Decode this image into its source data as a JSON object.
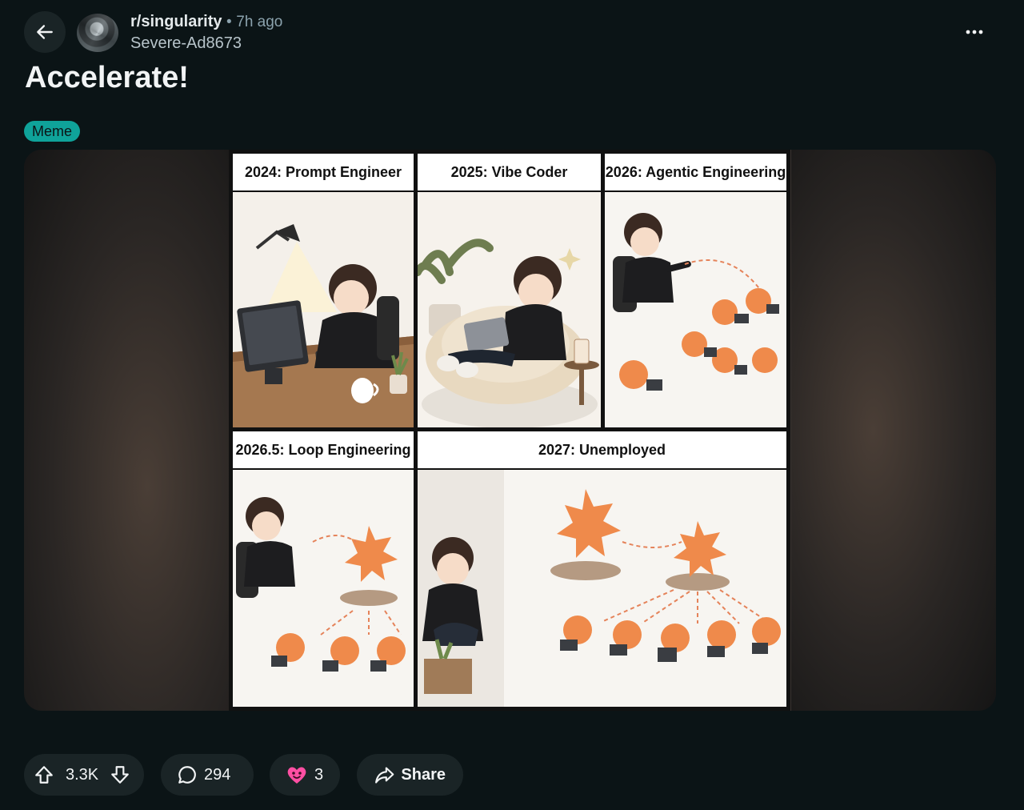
{
  "header": {
    "back_icon": "arrow-left-icon",
    "subreddit": "r/singularity",
    "separator": "•",
    "time_ago": "7h ago",
    "author": "Severe-Ad8673",
    "more_icon": "more-horizontal-icon"
  },
  "post": {
    "title": "Accelerate!",
    "flair": "Meme",
    "flair_color": "#0fa39a"
  },
  "comic": {
    "panels": [
      {
        "caption": "2024: Prompt Engineer"
      },
      {
        "caption": "2025: Vibe Coder"
      },
      {
        "caption": "2026: Agentic Engineering"
      },
      {
        "caption": "2026.5: Loop Engineering"
      },
      {
        "caption": "2027: Unemployed"
      }
    ]
  },
  "actions": {
    "vote_count": "3.3K",
    "comment_count": "294",
    "award_count": "3",
    "share_label": "Share",
    "icons": [
      "upvote-icon",
      "downvote-icon",
      "comment-icon",
      "award-icon",
      "share-icon"
    ]
  },
  "colors": {
    "background": "#0b1416",
    "button_bg": "#1a2426",
    "meta_text": "#8ba2ad",
    "award": "#ff4fa3"
  }
}
